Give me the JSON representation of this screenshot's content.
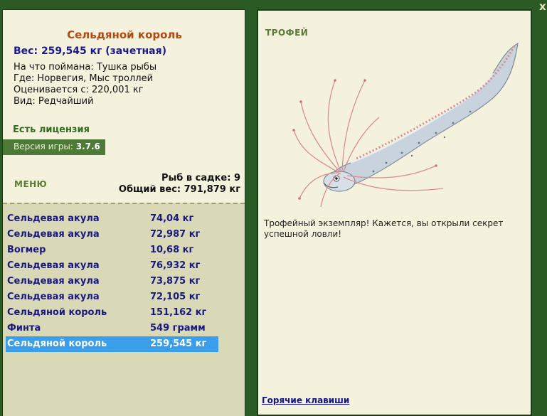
{
  "fish": {
    "name": "Сельдяной король",
    "weight_line": "Вес: 259,545 кг (зачетная)",
    "bait": "На что поймана: Тушка рыбы",
    "location": "Где: Норвегия, Мыс троллей",
    "rated_from": "Оценивается с: 220,001 кг",
    "kind": "Вид: Редчайший"
  },
  "license": "Есть лицензия",
  "version": {
    "label": "Версия игры: ",
    "value": "3.7.6"
  },
  "menu_label": "МЕНЮ",
  "keep": {
    "count_line": "Рыб в садке: 9",
    "total_line": "Общий вес: 791,879 кг"
  },
  "catch_list": [
    {
      "name": "Сельдевая акула",
      "weight": "74,04 кг"
    },
    {
      "name": "Сельдевая акула",
      "weight": "72,987 кг"
    },
    {
      "name": "Вогмер",
      "weight": "10,68 кг"
    },
    {
      "name": "Сельдевая акула",
      "weight": "76,932 кг"
    },
    {
      "name": "Сельдевая акула",
      "weight": "73,875 кг"
    },
    {
      "name": "Сельдевая акула",
      "weight": "72,105 кг"
    },
    {
      "name": "Сельдяной король",
      "weight": "151,162 кг"
    },
    {
      "name": "Финта",
      "weight": "549 грамм"
    },
    {
      "name": "Сельдяной король",
      "weight": "259,545 кг"
    }
  ],
  "selected_index": 8,
  "trophy": {
    "label": "ТРОФЕЙ",
    "text": "Трофейный экземпляр! Кажется, вы открыли секрет успешной ловли!"
  },
  "hotkeys_label": "Горячие клавиши",
  "close_label": "x",
  "colors": {
    "frame": "#2c5a25",
    "panel": "#f4f1dc",
    "list_bg": "#d9d8b7",
    "title": "#b24a14",
    "link": "#19197e",
    "selection": "#3a9eea"
  }
}
